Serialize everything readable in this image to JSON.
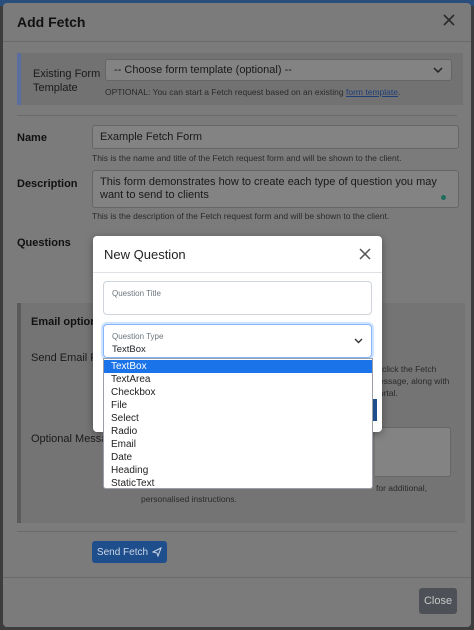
{
  "modal": {
    "title": "Add Fetch",
    "template_label": "Existing Form Template",
    "template_select": "-- Choose form template (optional) --",
    "template_help_prefix": "OPTIONAL: You can start a Fetch request based on an existing",
    "template_help_link": "form template",
    "template_help_suffix": ".",
    "name_label": "Name",
    "name_value": "Example Fetch Form",
    "name_help": "This is the name and title of the Fetch request form and will be shown to the client.",
    "description_label": "Description",
    "description_value": "This form demonstrates how to create each type of question you may want to send to clients",
    "description_help": "This is the description of the Fetch request form and will be shown to the client.",
    "questions_label": "Questions",
    "email_options_label": "Email options:",
    "send_email_label": "Send Email Requ",
    "send_email_help_1": "click the Fetch",
    "send_email_help_2": "essage, along with",
    "send_email_help_3": "ortal.",
    "optional_message_label": "Optional Message",
    "optional_help_1": "for additional,",
    "optional_help_2": "personalised instructions.",
    "send_button": "Send Fetch",
    "close_button": "Close"
  },
  "new_question": {
    "title": "New Question",
    "question_title_label": "Question Title",
    "question_type_label": "Question Type",
    "question_type_value": "TextBox",
    "options": [
      "TextBox",
      "TextArea",
      "Checkbox",
      "File",
      "Select",
      "Radio",
      "Email",
      "Date",
      "Heading",
      "StaticText"
    ],
    "selected_index": 0
  },
  "colors": {
    "selected_option": "#1a73e8",
    "primary_button": "#1e4e8c",
    "secondary_button": "#4d5157"
  }
}
